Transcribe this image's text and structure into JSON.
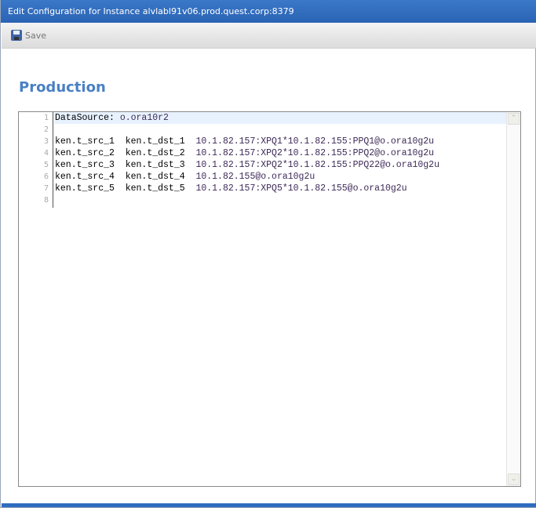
{
  "window": {
    "title": "Edit Configuration for Instance alvlabl91v06.prod.quest.corp:8379"
  },
  "toolbar": {
    "save_label": "Save",
    "save_icon": "floppy-disk-icon"
  },
  "heading": "Production",
  "editor": {
    "line_numbers": [
      "1",
      "2",
      "3",
      "4",
      "5",
      "6",
      "7",
      "8"
    ],
    "lines": [
      {
        "a": "DataSource: ",
        "b": "o.ora10r2"
      },
      {
        "a": "",
        "b": ""
      },
      {
        "a": "ken.t_src_1  ken.t_dst_1  ",
        "b": "10.1.82.157:XPQ1*10.1.82.155:PPQ1@o.ora10g2u"
      },
      {
        "a": "ken.t_src_2  ken.t_dst_2  ",
        "b": "10.1.82.157:XPQ2*10.1.82.155:PPQ2@o.ora10g2u"
      },
      {
        "a": "ken.t_src_3  ken.t_dst_3  ",
        "b": "10.1.82.157:XPQ2*10.1.82.155:PPQ22@o.ora10g2u"
      },
      {
        "a": "ken.t_src_4  ken.t_dst_4  ",
        "b": "10.1.82.155@o.ora10g2u"
      },
      {
        "a": "ken.t_src_5  ken.t_dst_5  ",
        "b": "10.1.82.157:XPQ5*10.1.82.155@o.ora10g2u"
      },
      {
        "a": "",
        "b": ""
      }
    ]
  }
}
